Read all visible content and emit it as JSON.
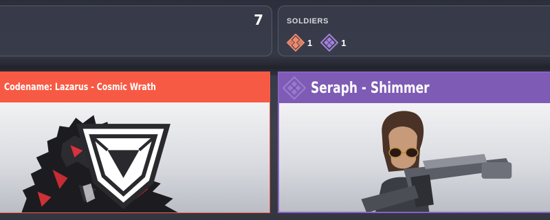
{
  "summary": {
    "left_count": "7",
    "soldiers_label": "SOLDIERS",
    "rarities": [
      {
        "name": "legendary",
        "icon": "orange-diamond-rank-icon",
        "color": "#f0896c",
        "count": "1"
      },
      {
        "name": "epic",
        "icon": "purple-diamond-rank-icon",
        "color": "#a383dc",
        "count": "1"
      }
    ]
  },
  "cards": [
    {
      "name": "Codename: Lazarus - Cosmic Wrath",
      "rarity_color": "#f75a44",
      "badge_icon": "tier-badge-icon"
    },
    {
      "name": "Seraph - Shimmer",
      "rarity_color": "#7e5bb5",
      "header_icon": "purple-diamond-rank-icon"
    }
  ]
}
